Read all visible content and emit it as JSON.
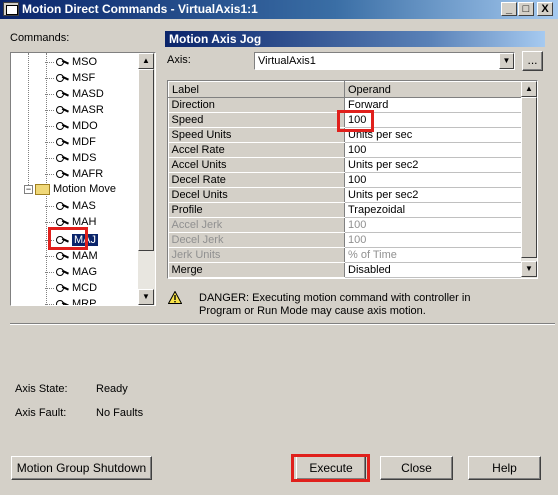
{
  "window": {
    "title": "Motion Direct Commands - VirtualAxis1:1",
    "minimize": "_",
    "maximize": "□",
    "close": "X"
  },
  "commands_label": "Commands:",
  "tree": {
    "items": [
      {
        "label": "MSO",
        "type": "command"
      },
      {
        "label": "MSF",
        "type": "command"
      },
      {
        "label": "MASD",
        "type": "command"
      },
      {
        "label": "MASR",
        "type": "command"
      },
      {
        "label": "MDO",
        "type": "command"
      },
      {
        "label": "MDF",
        "type": "command"
      },
      {
        "label": "MDS",
        "type": "command"
      },
      {
        "label": "MAFR",
        "type": "command"
      },
      {
        "label": "Motion Move",
        "type": "folder"
      },
      {
        "label": "MAS",
        "type": "command"
      },
      {
        "label": "MAH",
        "type": "command"
      },
      {
        "label": "MAJ",
        "type": "command",
        "selected": true
      },
      {
        "label": "MAM",
        "type": "command"
      },
      {
        "label": "MAG",
        "type": "command"
      },
      {
        "label": "MCD",
        "type": "command"
      },
      {
        "label": "MRP",
        "type": "command"
      }
    ]
  },
  "panel": {
    "header": "Motion Axis Jog",
    "axis_label": "Axis:",
    "axis_value": "VirtualAxis1",
    "browse_button": "..."
  },
  "grid": {
    "columns": [
      "Label",
      "Operand"
    ],
    "rows": [
      {
        "label": "Direction",
        "operand": "Forward",
        "enabled": true
      },
      {
        "label": "Speed",
        "operand": "100",
        "enabled": true
      },
      {
        "label": "Speed Units",
        "operand": "Units per sec",
        "enabled": true
      },
      {
        "label": "Accel Rate",
        "operand": "100",
        "enabled": true
      },
      {
        "label": "Accel Units",
        "operand": "Units per sec2",
        "enabled": true
      },
      {
        "label": "Decel Rate",
        "operand": "100",
        "enabled": true
      },
      {
        "label": "Decel Units",
        "operand": "Units per sec2",
        "enabled": true
      },
      {
        "label": "Profile",
        "operand": "Trapezoidal",
        "enabled": true
      },
      {
        "label": "Accel Jerk",
        "operand": "100",
        "enabled": false
      },
      {
        "label": "Decel Jerk",
        "operand": "100",
        "enabled": false
      },
      {
        "label": "Jerk Units",
        "operand": "% of Time",
        "enabled": false
      },
      {
        "label": "Merge",
        "operand": "Disabled",
        "enabled": true
      }
    ]
  },
  "warning": {
    "line1": "DANGER: Executing motion command with controller in",
    "line2": "Program or Run Mode may cause axis motion."
  },
  "status": {
    "axis_state_label": "Axis State:",
    "axis_state_value": "Ready",
    "axis_fault_label": "Axis Fault:",
    "axis_fault_value": "No Faults"
  },
  "buttons": {
    "shutdown": "Motion Group Shutdown",
    "execute": "Execute",
    "close": "Close",
    "help": "Help"
  },
  "colors": {
    "highlight_box": "#e0201c",
    "selection": "#0a246a",
    "titlebar": "#0a246a"
  }
}
